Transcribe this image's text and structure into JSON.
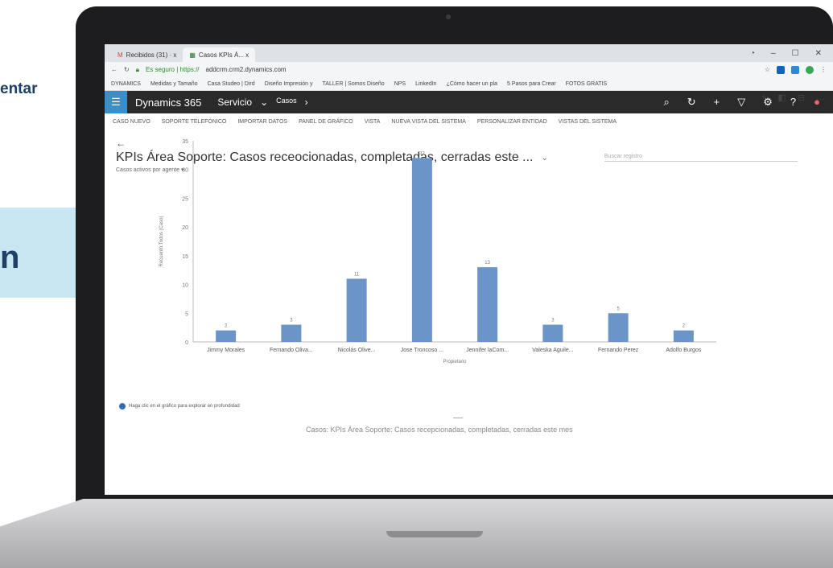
{
  "background": {
    "heading_fragment": "entar",
    "panel_fragment": "n"
  },
  "browser": {
    "tabs": [
      {
        "label": "Recibidos (31) · x",
        "icon": "gmail-icon"
      },
      {
        "label": "Casos KPIs Á... x",
        "icon": "dynamics-icon"
      }
    ],
    "url_prefix": "Es seguro | https://",
    "url": "addcrm.crm2.dynamics.com",
    "bookmarks": [
      "DYNAMICS",
      "Medidas y Tamaño",
      "Casa Studeo | Dird",
      "Diseño Impresión y",
      "TALLER | Somos Diseño",
      "NPS",
      "LinkedIn",
      "¿Cómo hacer un pla",
      "5 Pasos para Crear",
      "FOTOS GRATIS"
    ]
  },
  "app": {
    "name": "Dynamics 365",
    "area": "Servicio",
    "entity": "Casos"
  },
  "commands": [
    "CASO NUEVO",
    "SOPORTE TELEFÓNICO",
    "IMPORTAR DATOS",
    "PANEL DE GRÁFICO",
    "VISTA",
    "NUEVA VISTA DEL SISTEMA",
    "PERSONALIZAR ENTIDAD",
    "VISTAS DEL SISTEMA"
  ],
  "view": {
    "back_label": "←",
    "title": "KPIs Área Soporte: Casos receocionadas, completadas, cerradas este ...",
    "search_placeholder": "Buscar registro",
    "chart_selector": "Casos activos por agente ▾",
    "footer_note": "Haga clic en el gráfico para explorar en profundidad",
    "caption": "Casos: KPIs Área Soporte: Casos recepcionadas, completadas, cerradas este mes"
  },
  "colors": {
    "bar": "#6b94c9",
    "d365_bar": "#2a2a2a",
    "waffle": "#3c8ec9"
  },
  "chart_data": {
    "type": "bar",
    "categories": [
      "Jimmy Morales",
      "Fernando Oliva...",
      "Nicolás Olive...",
      "Jose Troncoso ...",
      "Jennifer laCom...",
      "Valeska Aguile...",
      "Fernando Perez",
      "Adolfo Burgos"
    ],
    "values": [
      2,
      3,
      11,
      32,
      13,
      3,
      5,
      2
    ],
    "xlabel": "Propietario",
    "ylabel": "Recuento:Todos (Caso)",
    "ylim": [
      0,
      35
    ],
    "yticks": [
      0,
      5,
      10,
      15,
      20,
      25,
      30,
      35
    ]
  }
}
